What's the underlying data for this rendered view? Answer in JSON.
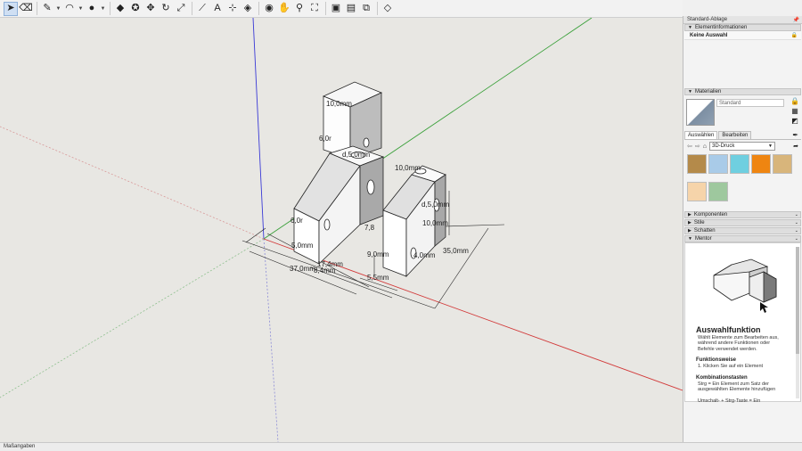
{
  "toolbar": {
    "tools": [
      {
        "name": "select-tool-icon",
        "glyph": "➤",
        "active": true
      },
      {
        "name": "eraser-tool-icon",
        "glyph": "⌫"
      },
      {
        "name": "line-tool-icon",
        "glyph": "✎",
        "dropdown": true
      },
      {
        "name": "arc-tool-icon",
        "glyph": "◠",
        "dropdown": true
      },
      {
        "name": "shape-tool-icon",
        "glyph": "●",
        "dropdown": true
      },
      {
        "name": "push-pull-tool-icon",
        "glyph": "◆"
      },
      {
        "name": "follow-me-tool-icon",
        "glyph": "✪"
      },
      {
        "name": "move-tool-icon",
        "glyph": "✥"
      },
      {
        "name": "rotate-tool-icon",
        "glyph": "↻"
      },
      {
        "name": "scale-tool-icon",
        "glyph": "⤢"
      },
      {
        "name": "tape-measure-tool-icon",
        "glyph": "⟋"
      },
      {
        "name": "text-tool-icon",
        "glyph": "A"
      },
      {
        "name": "axes-tool-icon",
        "glyph": "⊹"
      },
      {
        "name": "paint-bucket-tool-icon",
        "glyph": "◈"
      },
      {
        "name": "orbit-tool-icon",
        "glyph": "◉"
      },
      {
        "name": "pan-tool-icon",
        "glyph": "✋"
      },
      {
        "name": "zoom-tool-icon",
        "glyph": "⚲"
      },
      {
        "name": "zoom-extents-tool-icon",
        "glyph": "⛶"
      },
      {
        "name": "warehouse-icon",
        "glyph": "▣"
      },
      {
        "name": "extension-warehouse-icon",
        "glyph": "▤"
      },
      {
        "name": "layout-icon",
        "glyph": "⧉"
      },
      {
        "name": "ruby-console-icon",
        "glyph": "◇"
      }
    ]
  },
  "tray": {
    "title": "Standard-Ablage",
    "pin_glyph": "📌",
    "entity_info": {
      "header": "Elementinformationen",
      "value": "Keine Auswahl",
      "lock_glyph": "🔒"
    },
    "materials": {
      "header": "Materialien",
      "name_placeholder": "Standard",
      "tabs": [
        "Auswählen",
        "Bearbeiten"
      ],
      "collection": "3D-Druck",
      "swatches": [
        "#b48a4a",
        "#a9cbe8",
        "#6fcfe0",
        "#ef8511",
        "#d8b57b",
        "#f6d4aa",
        "#9ec89e"
      ]
    },
    "panels": [
      {
        "label": "Komponenten",
        "expanded": false
      },
      {
        "label": "Stile",
        "expanded": false
      },
      {
        "label": "Schatten",
        "expanded": false
      },
      {
        "label": "Mentor",
        "expanded": true
      }
    ],
    "mentor": {
      "title": "Auswahlfunktion",
      "description": "Wählt Elemente zum Bearbeiten aus, während andere Funktionen oder Befehle verwendet werden.",
      "operation_heading": "Funktionsweise",
      "operation_text": "1. Klicken Sie auf ein Element",
      "modifier_heading": "Kombinationstasten",
      "modifier_text": "Strg = Ein Element zum Satz der ausgewählten Elemente hinzufügen",
      "modifier_text2": "Umschalt- + Strg-Taste = Ein"
    }
  },
  "viewport": {
    "dimensions": [
      "10,0mm",
      "6,0r",
      "d,5,0mm",
      "10,0mm",
      "d,5,0mm",
      "10,0mm",
      "6,0r",
      "7,8",
      "9,0mm",
      "4,0mm",
      "35,0mm",
      "5,0mm",
      "17,4mm",
      "37,0mm",
      "8,4mm",
      "5,5mm"
    ]
  },
  "status": {
    "label": "Maßangaben"
  }
}
